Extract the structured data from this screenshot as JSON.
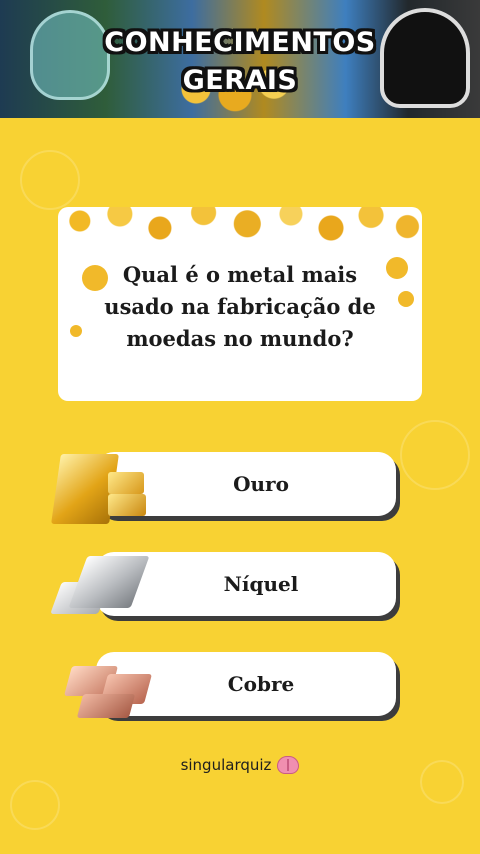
{
  "header": {
    "title_line1": "CONHECIMENTOS",
    "title_line2": "GERAIS"
  },
  "question": {
    "text": "Qual é o metal mais usado na fabricação de moedas no mundo?"
  },
  "options": [
    {
      "label": "Ouro",
      "icon": "gold-bars-icon"
    },
    {
      "label": "Níquel",
      "icon": "nickel-bars-icon"
    },
    {
      "label": "Cobre",
      "icon": "copper-bars-icon"
    }
  ],
  "footer": {
    "brand": "singularquiz",
    "icon": "brain-icon"
  },
  "colors": {
    "background": "#f8d233",
    "card": "#ffffff",
    "option_shadow": "#3d3d3d"
  }
}
